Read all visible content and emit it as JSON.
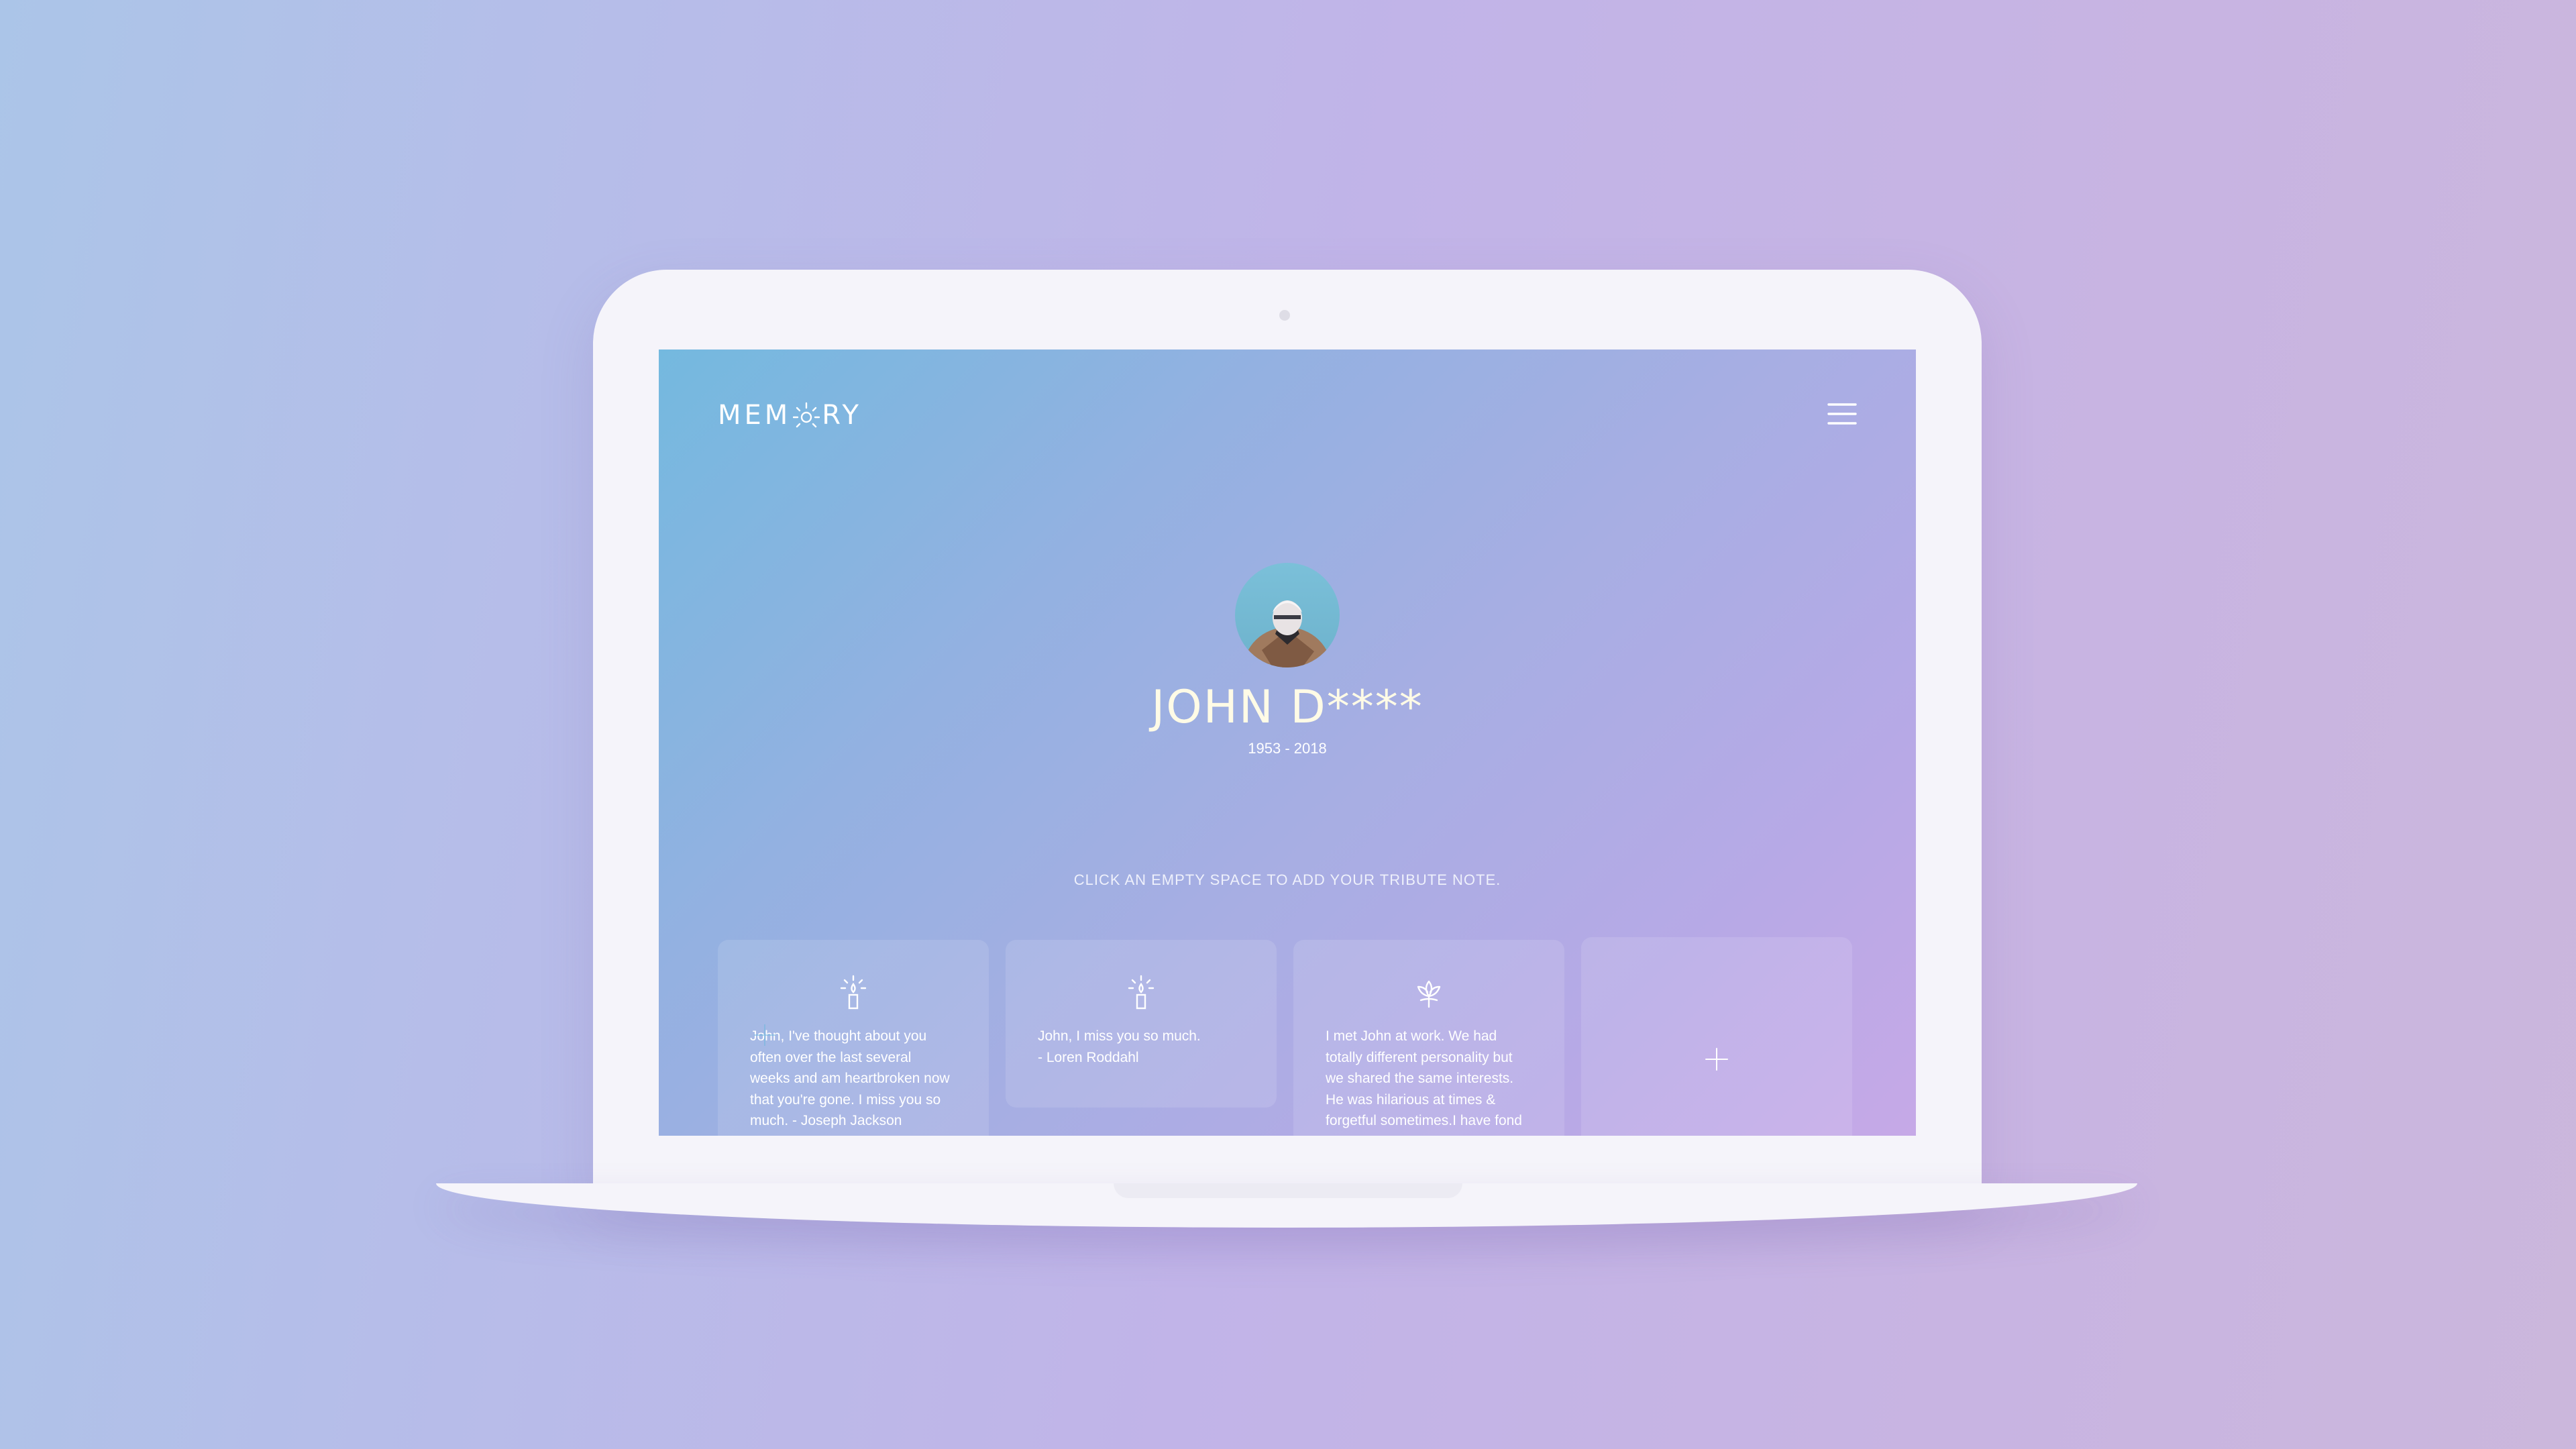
{
  "app": {
    "logo": "MEMORY"
  },
  "profile": {
    "name": "JOHN D****",
    "dates": "1953 - 2018"
  },
  "instruction": "CLICK AN EMPTY SPACE TO ADD YOUR TRIBUTE NOTE.",
  "cards": [
    {
      "icon": "candle-icon",
      "text": "John, I've thought about you\noften over the last several\nweeks and am heartbroken now\nthat you're gone. I miss you so\nmuch. - Joseph Jackson"
    },
    {
      "icon": "candle-icon",
      "text": "John, I miss you so much.\n- Loren Roddahl"
    },
    {
      "icon": "lotus-icon",
      "text": "I met John at work. We had\ntotally different personality but\nwe shared the same interests.\nHe was hilarious at times &\nforgetful sometimes.I have fond"
    },
    {
      "icon": "plus-icon",
      "text": ""
    }
  ],
  "colors": {
    "screen_gradient_start": "#74b9df",
    "screen_gradient_end": "#c6a9e7",
    "name_color": "#fffbe6",
    "laptop_body": "#f5f4fa"
  }
}
